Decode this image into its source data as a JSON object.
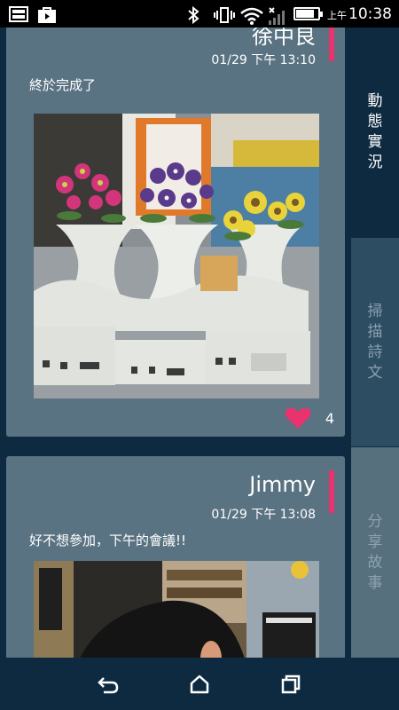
{
  "status_bar": {
    "ampm": "上午",
    "time": "10:38",
    "battery_level": 0.85
  },
  "feed": {
    "posts": [
      {
        "author": "徐中良",
        "date": "01/29 下午 13:10",
        "message": "終於完成了",
        "likes": "4"
      },
      {
        "author": "Jimmy",
        "date": "01/29 下午 13:08",
        "message": "好不想參加，下午的會議!!"
      }
    ]
  },
  "tabs": [
    {
      "label": "動態實況",
      "active": true
    },
    {
      "label": "掃描詩文",
      "active": false
    },
    {
      "label": "分享故事",
      "active": false
    }
  ],
  "colors": {
    "accent": "#e8336f",
    "background": "#0e2a40",
    "card": "#5a7382"
  },
  "nav": {
    "icons": [
      "back-icon",
      "home-icon",
      "recents-icon"
    ]
  }
}
